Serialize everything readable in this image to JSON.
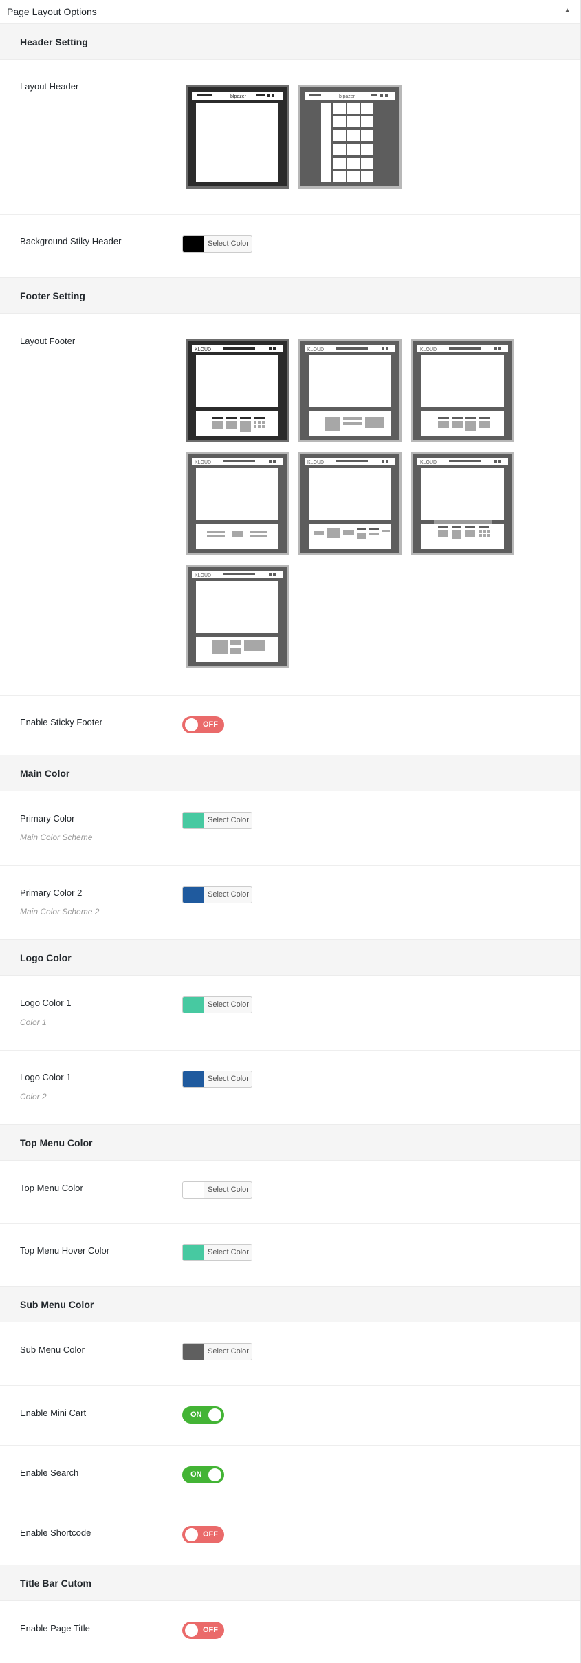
{
  "panel": {
    "title": "Page Layout Options",
    "collapse_icon": "triangle-up-icon"
  },
  "sections": {
    "header": "Header Setting",
    "footer": "Footer Setting",
    "main_color": "Main Color",
    "logo_color": "Logo Color",
    "top_menu": "Top Menu Color",
    "sub_menu": "Sub Menu Color",
    "title_bar": "Title Bar Cutom"
  },
  "fields": {
    "layout_header": {
      "label": "Layout Header",
      "thumb_text": [
        "blpazer",
        "blpazer"
      ]
    },
    "bg_sticky_header": {
      "label": "Background Stiky Header",
      "color": "#000000",
      "button": "Select Color"
    },
    "layout_footer": {
      "label": "Layout Footer",
      "thumb_text": [
        "KLOUD",
        "KLOUD",
        "KLOUD",
        "KLOUD",
        "KLOUD",
        "KLOUD",
        "KLOUD"
      ]
    },
    "sticky_footer": {
      "label": "Enable Sticky Footer",
      "state": "OFF"
    },
    "primary_color": {
      "label": "Primary Color",
      "desc": "Main Color Scheme",
      "color": "#47c9a1",
      "button": "Select Color"
    },
    "primary_color_2": {
      "label": "Primary Color 2",
      "desc": "Main Color Scheme 2",
      "color": "#1f5a9e",
      "button": "Select Color"
    },
    "logo_color_1": {
      "label": "Logo Color 1",
      "desc": "Color 1",
      "color": "#47c9a1",
      "button": "Select Color"
    },
    "logo_color_2": {
      "label": "Logo Color 1",
      "desc": "Color 2",
      "color": "#1f5a9e",
      "button": "Select Color"
    },
    "top_menu_color": {
      "label": "Top Menu Color",
      "color": "#ffffff",
      "button": "Select Color"
    },
    "top_menu_hover": {
      "label": "Top Menu Hover Color",
      "color": "#47c9a1",
      "button": "Select Color"
    },
    "sub_menu_color": {
      "label": "Sub Menu Color",
      "color": "#5f5f5f",
      "button": "Select Color"
    },
    "mini_cart": {
      "label": "Enable Mini Cart",
      "state": "ON"
    },
    "search": {
      "label": "Enable Search",
      "state": "ON"
    },
    "shortcode": {
      "label": "Enable Shortcode",
      "state": "OFF"
    },
    "page_title": {
      "label": "Enable Page Title",
      "state": "OFF"
    }
  },
  "colors": {
    "on": "#43b435",
    "off": "#ea6a6a",
    "section_bg": "#f5f5f5"
  }
}
